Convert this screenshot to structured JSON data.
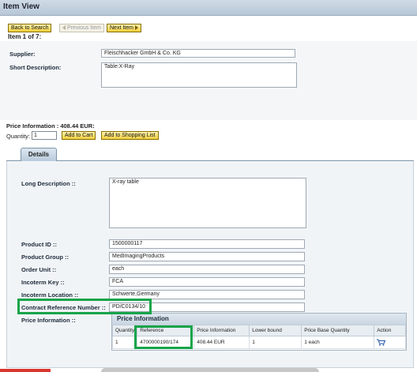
{
  "window": {
    "title": "Item View"
  },
  "toolbar": {
    "back_label": "Back to Search",
    "prev_label": "Previous Item",
    "next_label": "Next Item",
    "item_counter": "Item 1 of 7:"
  },
  "header": {
    "supplier_label": "Supplier:",
    "supplier_value": "Fleischhacker GmbH & Co. KG",
    "short_desc_label": "Short Description:",
    "short_desc_value": "Table:X-Ray"
  },
  "price_bar": {
    "price_info": "Price Information : 408.44 EUR:",
    "quantity_label": "Quantity:",
    "quantity_value": "1",
    "add_to_cart_label": "Add to Cart",
    "add_to_list_label": "Add to Shopping List"
  },
  "tabs": [
    {
      "label": "Details"
    }
  ],
  "details": {
    "long_desc_label": "Long Description ::",
    "long_desc_value": "X-ray table",
    "product_id_label": "Product ID ::",
    "product_id_value": "1500000117",
    "product_group_label": "Product Group ::",
    "product_group_value": "MedImagingProducts",
    "order_unit_label": "Order Unit ::",
    "order_unit_value": "each",
    "incoterm_key_label": "Incoterm Key ::",
    "incoterm_key_value": "FCA",
    "incoterm_location_label": "Incoterm Location ::",
    "incoterm_location_value": "Schwerte,Germany",
    "contract_ref_label": "Contract Reference Number ::",
    "contract_ref_value": "PD/C0134/10",
    "price_info_label": "Price Information ::"
  },
  "price_table": {
    "caption": "Price Information",
    "columns": [
      "Quantity",
      "Reference",
      "Price Information",
      "Lower bound",
      "Price Base Quantity",
      "Action"
    ],
    "rows": [
      {
        "quantity": "1",
        "reference": "4700000190/174",
        "price": "408.44 EUR",
        "lower_bound": "1",
        "base_qty": "1 each"
      }
    ]
  },
  "colors": {
    "highlight": "#17a44a",
    "button": "#f2cf3c",
    "header": "#c9d6e2"
  },
  "icons": {
    "cart": "shopping-cart-icon"
  }
}
